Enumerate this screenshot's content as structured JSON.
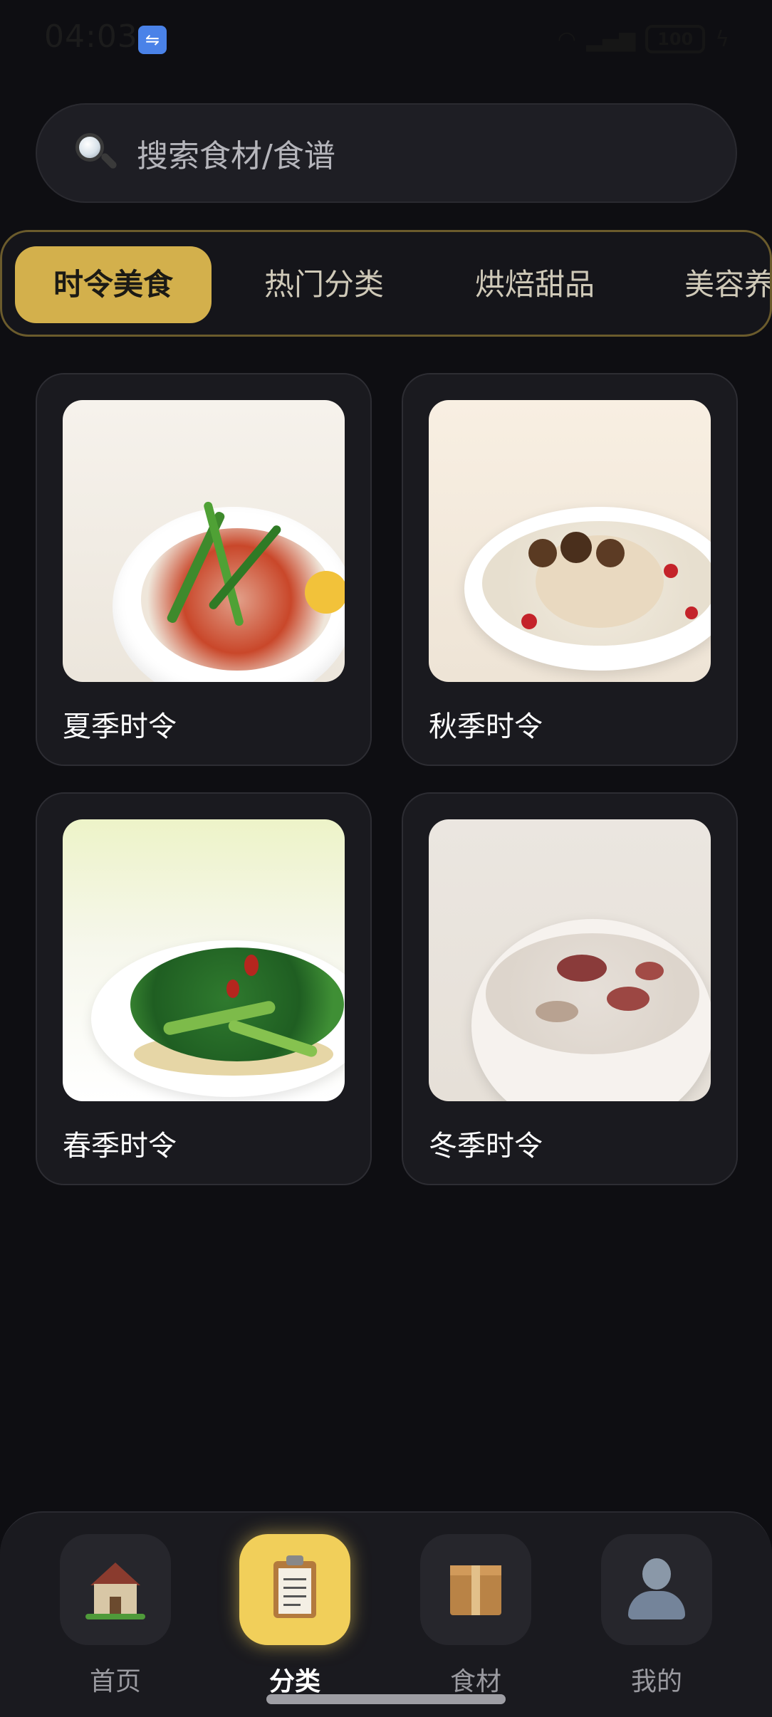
{
  "status_bar": {
    "time": "04:03",
    "battery": "100"
  },
  "search": {
    "placeholder": "搜索食材/食谱"
  },
  "tabs": [
    {
      "label": "时令美食",
      "active": true
    },
    {
      "label": "热门分类",
      "active": false
    },
    {
      "label": "烘焙甜品",
      "active": false
    },
    {
      "label": "美容养",
      "active": false
    }
  ],
  "cards": [
    {
      "label": "夏季时令"
    },
    {
      "label": "秋季时令"
    },
    {
      "label": "春季时令"
    },
    {
      "label": "冬季时令"
    }
  ],
  "bottom_nav": [
    {
      "label": "首页",
      "icon": "house-icon",
      "active": false
    },
    {
      "label": "分类",
      "icon": "clipboard-icon",
      "active": true
    },
    {
      "label": "食材",
      "icon": "package-icon",
      "active": false
    },
    {
      "label": "我的",
      "icon": "person-icon",
      "active": false
    }
  ],
  "colors": {
    "background": "#0e0e12",
    "accent_gold": "#d3b04c",
    "nav_active": "#f1cf5a",
    "usb_badge": "#4a82e8"
  }
}
